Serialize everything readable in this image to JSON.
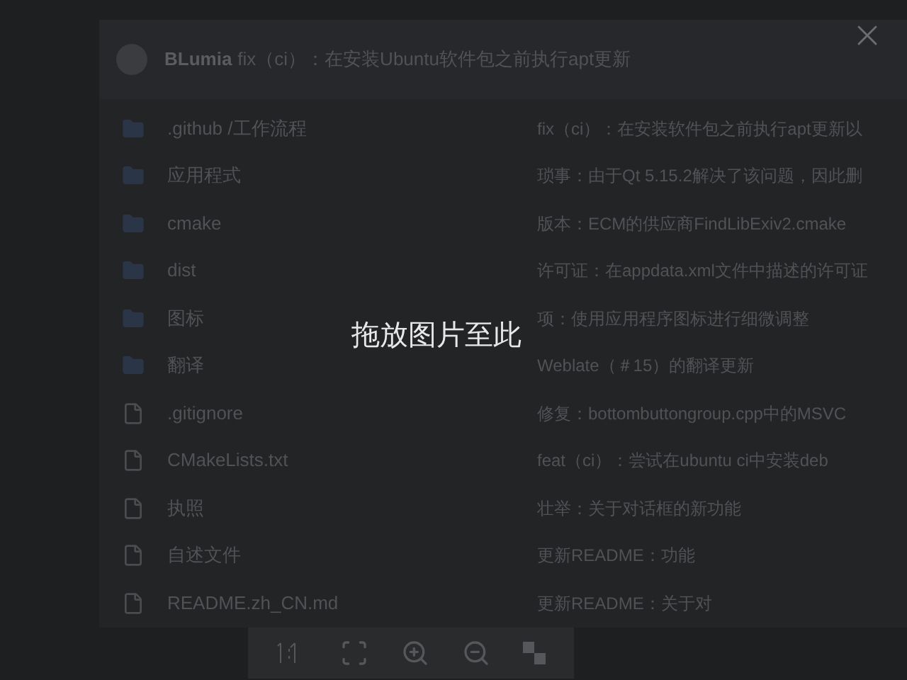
{
  "viewer": {
    "hint": "拖放图片至此"
  },
  "page": {
    "repo": "BLumia",
    "commit": "fix（ci）：在安装Ubuntu软件包之前执行apt更新",
    "files": [
      {
        "kind": "folder",
        "name": ".github /工作流程",
        "message": "fix（ci）：在安装软件包之前执行apt更新以"
      },
      {
        "kind": "folder",
        "name": "应用程式",
        "message": "琐事：由于Qt 5.15.2解决了该问题，因此删"
      },
      {
        "kind": "folder",
        "name": "cmake",
        "message": "版本：ECM的供应商FindLibExiv2.cmake"
      },
      {
        "kind": "folder",
        "name": "dist",
        "message": "许可证：在appdata.xml文件中描述的许可证"
      },
      {
        "kind": "folder",
        "name": "图标",
        "message": "项：使用应用程序图标进行细微调整"
      },
      {
        "kind": "folder",
        "name": "翻译",
        "message": "Weblate（＃15）的翻译更新"
      },
      {
        "kind": "file",
        "name": ".gitignore",
        "message": "修复：bottombuttongroup.cpp中的MSVC"
      },
      {
        "kind": "file",
        "name": "CMakeLists.txt",
        "message": "feat（ci）：尝试在ubuntu ci中安装deb"
      },
      {
        "kind": "file",
        "name": "执照",
        "message": "壮举：关于对话框的新功能"
      },
      {
        "kind": "file",
        "name": "自述文件",
        "message": "更新README：功能"
      },
      {
        "kind": "file",
        "name": "README.zh_CN.md",
        "message": "更新README：关于对"
      }
    ]
  }
}
